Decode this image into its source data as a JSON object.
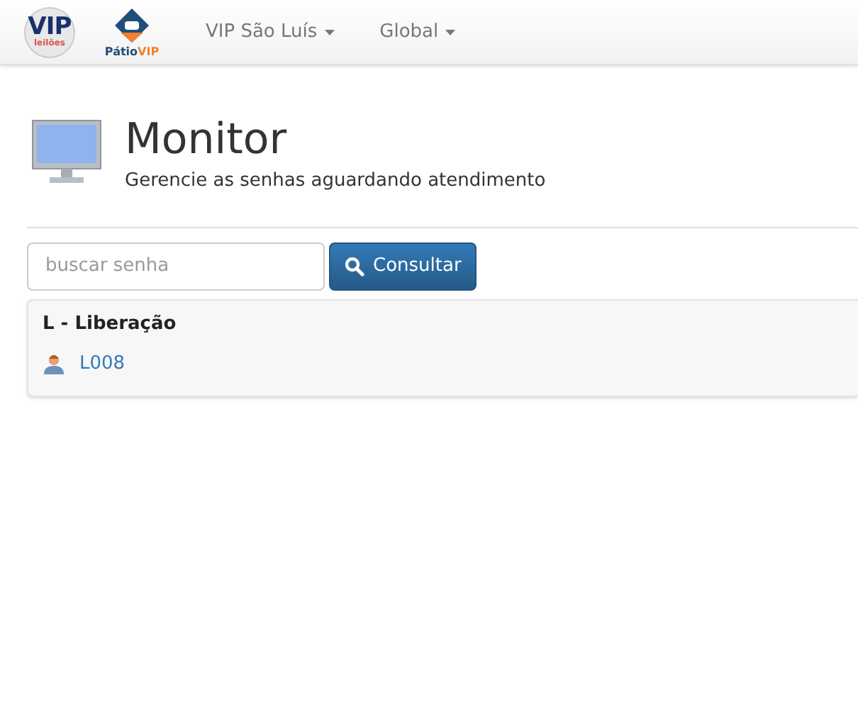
{
  "navbar": {
    "logo": {
      "title": "VIP",
      "subtitle": "leilões"
    },
    "logo_2": {
      "first": "Pátio",
      "second": "VIP"
    },
    "menus": [
      {
        "label": "VIP São Luís"
      },
      {
        "label": "Global"
      }
    ]
  },
  "header": {
    "title": "Monitor",
    "subtitle": "Gerencie as senhas aguardando atendimento"
  },
  "search": {
    "placeholder": "buscar senha",
    "button": "Consultar"
  },
  "groups": [
    {
      "title": "L - Liberação",
      "tickets": [
        "L008"
      ]
    }
  ]
}
